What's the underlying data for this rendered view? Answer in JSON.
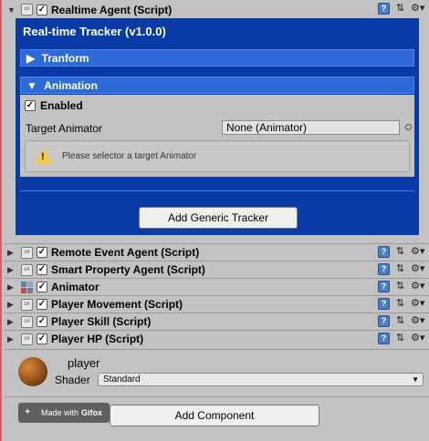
{
  "main_component": {
    "title": "Realtime Agent (Script)",
    "panel_title": "Real-time Tracker (v1.0.0)",
    "transform_section": "Tranform",
    "animation_section": "Animation",
    "enabled_label": "Enabled",
    "target_label": "Target Animator",
    "target_value": "None (Animator)",
    "warning": "Please selector a target Animator",
    "generic_button": "Add Generic Tracker"
  },
  "components": [
    {
      "title": "Remote Event Agent (Script)",
      "icon": "script-icon"
    },
    {
      "title": "Smart Property Agent (Script)",
      "icon": "script-icon"
    },
    {
      "title": "Animator",
      "icon": "animator-icon"
    },
    {
      "title": "Player Movement (Script)",
      "icon": "script-icon"
    },
    {
      "title": "Player Skill (Script)",
      "icon": "script-icon"
    },
    {
      "title": "Player HP (Script)",
      "icon": "script-icon"
    }
  ],
  "material": {
    "name": "player",
    "shader_label": "Shader",
    "shader_value": "Standard"
  },
  "footer": {
    "gifox_prefix": "Made with",
    "gifox_brand": "Gifox",
    "add_component": "Add Component"
  },
  "colors": {
    "panel": "#0a3aa6",
    "section_bar": "#2c6ad8",
    "inspector_bg": "#c2c2c2"
  }
}
